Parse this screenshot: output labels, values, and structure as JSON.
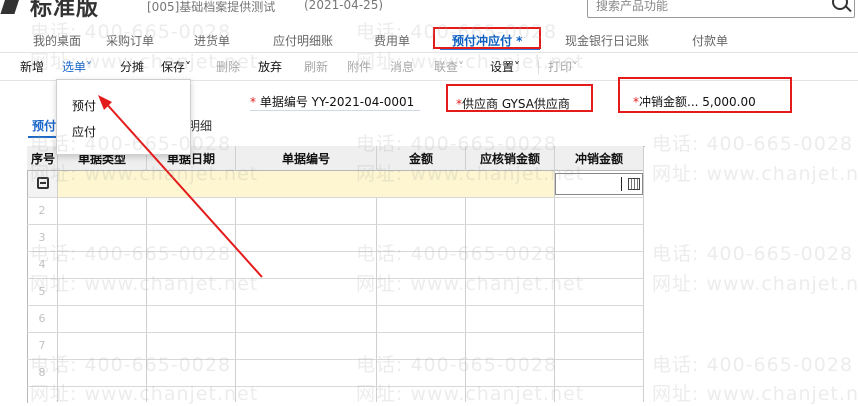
{
  "header": {
    "app_title": "标准版",
    "subtitle": "[005]基础档案提供测试",
    "date": "(2021-04-25)",
    "search_placeholder": "搜索产品功能"
  },
  "tabs": [
    {
      "label": "我的桌面"
    },
    {
      "label": "采购订单"
    },
    {
      "label": "进货单"
    },
    {
      "label": "应付明细账"
    },
    {
      "label": "费用单"
    },
    {
      "label": "预付冲应付 *"
    },
    {
      "label": "现金银行日记账"
    },
    {
      "label": "付款单"
    }
  ],
  "toolbar": {
    "new": "新增",
    "select": "选单",
    "split": "分摊",
    "save": "保存",
    "delete": "删除",
    "abandon": "放弃",
    "refresh": "刷新",
    "attachment": "附件",
    "message": "消息",
    "link": "联查",
    "settings": "设置",
    "print": "打印"
  },
  "dropdown": {
    "items": [
      {
        "label": "预付"
      },
      {
        "label": "应付"
      }
    ]
  },
  "form": {
    "doc_no_label": "单据编号",
    "doc_no_value": "YY-2021-04-0001",
    "supplier_label": "供应商",
    "supplier_value": "GYSA供应商",
    "writeoff_label": "冲销金额...",
    "writeoff_value": "5,000.00",
    "required_mark": "*"
  },
  "subtabs": {
    "prepay": "预付",
    "detail": "明细"
  },
  "grid": {
    "columns": [
      "序号",
      "单据类型",
      "单据日期",
      "单据编号",
      "金额",
      "应核销金额",
      "冲销金额"
    ],
    "row_numbers": [
      "2",
      "3",
      "4",
      "5",
      "6",
      "7",
      "8"
    ]
  },
  "watermark": {
    "phone": "电话: 400-665-0028",
    "site": "网址: www.chanjet.net"
  },
  "colors": {
    "accent": "#2a74d9",
    "highlight_box": "#e31b1b",
    "row_highlight": "#fdf6d0"
  }
}
